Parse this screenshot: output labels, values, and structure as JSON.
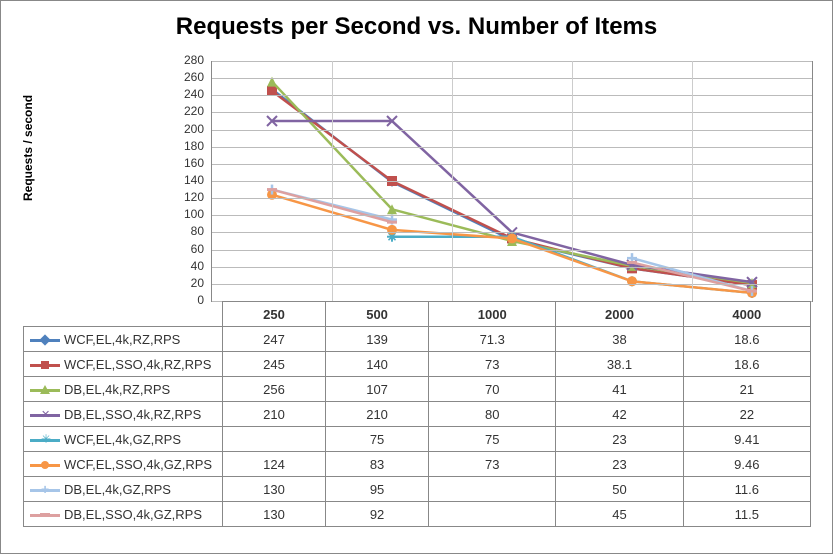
{
  "chart_data": {
    "type": "line",
    "title": "Requests per Second vs. Number of Items",
    "ylabel": "Requests / second",
    "xlabel": "",
    "categories": [
      "250",
      "500",
      "1000",
      "2000",
      "4000"
    ],
    "ylim": [
      0,
      280
    ],
    "yticks": [
      0,
      20,
      40,
      60,
      80,
      100,
      120,
      140,
      160,
      180,
      200,
      220,
      240,
      260,
      280
    ],
    "series": [
      {
        "name": "WCF,EL,4k,RZ,RPS",
        "color": "#4F81BD",
        "marker": "diamond",
        "values": [
          247,
          139,
          71.3,
          38,
          18.6
        ]
      },
      {
        "name": "WCF,EL,SSO,4k,RZ,RPS",
        "color": "#C0504D",
        "marker": "square",
        "values": [
          245,
          140,
          73,
          38.1,
          18.6
        ]
      },
      {
        "name": "DB,EL,4k,RZ,RPS",
        "color": "#9BBB59",
        "marker": "triangle",
        "values": [
          256,
          107,
          70,
          41,
          21
        ]
      },
      {
        "name": "DB,EL,SSO,4k,RZ,RPS",
        "color": "#8064A2",
        "marker": "cross",
        "values": [
          210,
          210,
          80,
          42,
          22
        ]
      },
      {
        "name": "WCF,EL,4k,GZ,RPS",
        "color": "#4BACC6",
        "marker": "star",
        "values": [
          null,
          75,
          75,
          23,
          9.41
        ]
      },
      {
        "name": "WCF,EL,SSO,4k,GZ,RPS",
        "color": "#F79646",
        "marker": "circle",
        "values": [
          124,
          83,
          73,
          23,
          9.46
        ]
      },
      {
        "name": "DB,EL,4k,GZ,RPS",
        "color": "#A6C5E8",
        "marker": "plus",
        "values": [
          130,
          95,
          null,
          50,
          11.6
        ]
      },
      {
        "name": "DB,EL,SSO,4k,GZ,RPS",
        "color": "#DDA0A0",
        "marker": "dash",
        "values": [
          130,
          92,
          null,
          45,
          11.5
        ]
      }
    ]
  }
}
